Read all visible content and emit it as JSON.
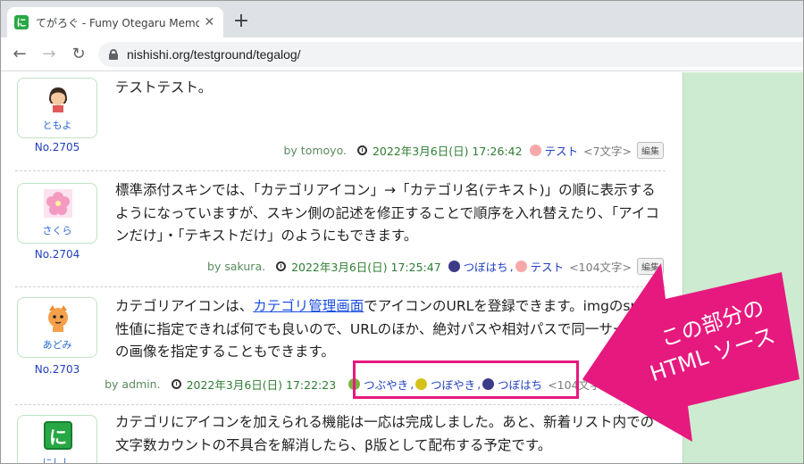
{
  "browser": {
    "tab_title": "てがろぐ - Fumy Otegaru Memo Lo",
    "favicon_glyph": "に",
    "close_glyph": "✕",
    "new_tab_glyph": "+",
    "url": "nishishi.org/testground/tegalog/",
    "back_glyph": "←",
    "forward_glyph": "→",
    "reload_glyph": "↻"
  },
  "posts": [
    {
      "user": "ともよ",
      "avatar_color": "#f4c9a0",
      "post_no": "No.2705",
      "text": "テストテスト。",
      "by": "by tomoyo.",
      "datetime": "2022年3月6日(日) 17:26:42",
      "categories": [
        {
          "name": "テスト",
          "icon_color": "#f7a8a8"
        }
      ],
      "count": "<7文字>",
      "edit": "編集"
    },
    {
      "user": "さくら",
      "avatar_color": "#f7b7d2",
      "post_no": "No.2704",
      "text": "標準添付スキンでは、「カテゴリアイコン」→「カテゴリ名(テキスト)」の順に表示するようになっていますが、スキン側の記述を修正することで順序を入れ替えたり、「アイコンだけ」・「テキストだけ」のようにもできます。",
      "by": "by sakura.",
      "datetime": "2022年3月6日(日) 17:25:47",
      "categories": [
        {
          "name": "つぼはち",
          "icon_color": "#3b3b8a"
        },
        {
          "name": "テスト",
          "icon_color": "#f7a8a8"
        }
      ],
      "count": "<104文字>",
      "edit": "編集"
    },
    {
      "user": "あどみ",
      "avatar_color": "#f5a04a",
      "post_no": "No.2703",
      "text_before_link": "カテゴリアイコンは、",
      "link": "カテゴリ管理画面",
      "text_after_link": "でアイコンのURLを登録できます。imgのsrc属性値に指定できれば何でも良いので、URLのほか、絶対パスや相対パスで同一サーバ内の画像を指定することもできます。",
      "by": "by admin.",
      "datetime": "2022年3月6日(日) 17:22:23",
      "categories": [
        {
          "name": "つぶやき",
          "icon_color": "#7cb342"
        },
        {
          "name": "つぼやき",
          "icon_color": "#d4c21a"
        },
        {
          "name": "つぼはち",
          "icon_color": "#3b3b8a"
        }
      ],
      "count": "<104文字>"
    },
    {
      "user": "にしし",
      "avatar_color": "#27a844",
      "avatar_glyph": "に",
      "text": "カテゴリにアイコンを加えられる機能は一応は完成しました。あと、新着リスト内での文字数カウントの不具合を解消したら、β版として配布する予定です。"
    }
  ],
  "annotation": {
    "line1": "この部分の",
    "line2": "HTML ソース",
    "color": "#e6197f"
  }
}
